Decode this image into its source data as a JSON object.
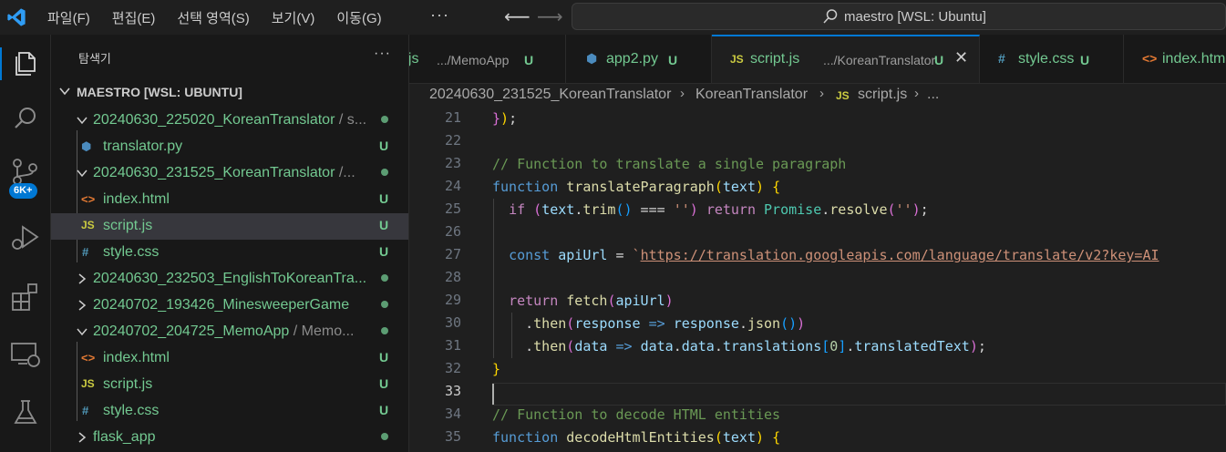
{
  "titlebar": {
    "menu": [
      "파일(F)",
      "편집(E)",
      "선택 영역(S)",
      "보기(V)",
      "이동(G)"
    ],
    "more": "···",
    "search_text": "maestro [WSL: Ubuntu]"
  },
  "activity": {
    "badge": "6K+"
  },
  "sidebar": {
    "title": "탐색기",
    "more": "···",
    "root": "MAESTRO [WSL: UBUNTU]",
    "rows": [
      {
        "name": "20240630_225020_KoreanTranslator",
        "sub": " / s..."
      },
      {
        "name": "translator.py",
        "status": "U"
      },
      {
        "name": "20240630_231525_KoreanTranslator",
        "sub": " /..."
      },
      {
        "name": "index.html",
        "status": "U"
      },
      {
        "name": "script.js",
        "status": "U"
      },
      {
        "name": "style.css",
        "status": "U"
      },
      {
        "name": "20240630_232503_EnglishToKoreanTra..."
      },
      {
        "name": "20240702_193426_MinesweeperGame"
      },
      {
        "name": "20240702_204725_MemoApp",
        "sub": " / Memo..."
      },
      {
        "name": "index.html",
        "status": "U"
      },
      {
        "name": "script.js",
        "status": "U"
      },
      {
        "name": "style.css",
        "status": "U"
      },
      {
        "name": "flask_app"
      }
    ]
  },
  "tabs": [
    {
      "icon": "",
      "name": "t.js",
      "desc": ".../MemoApp",
      "status": "U"
    },
    {
      "icon": "",
      "name": "app2.py",
      "desc": "",
      "status": "U"
    },
    {
      "icon": "JS",
      "name": "script.js",
      "desc": ".../KoreanTranslator",
      "status": "U",
      "close": "✕"
    },
    {
      "icon": "#",
      "name": "style.css",
      "desc": "",
      "status": "U"
    },
    {
      "icon": "<>",
      "name": "index.htm",
      "desc": "",
      "status": ""
    }
  ],
  "breadcrumb": [
    "20240630_231525_KoreanTranslator",
    "KoreanTranslator",
    "script.js",
    "..."
  ],
  "breadcrumb_icon": "JS",
  "editor": {
    "line_numbers": [
      "21",
      "22",
      "23",
      "24",
      "25",
      "26",
      "27",
      "28",
      "29",
      "30",
      "31",
      "32",
      "33",
      "34",
      "35"
    ]
  }
}
